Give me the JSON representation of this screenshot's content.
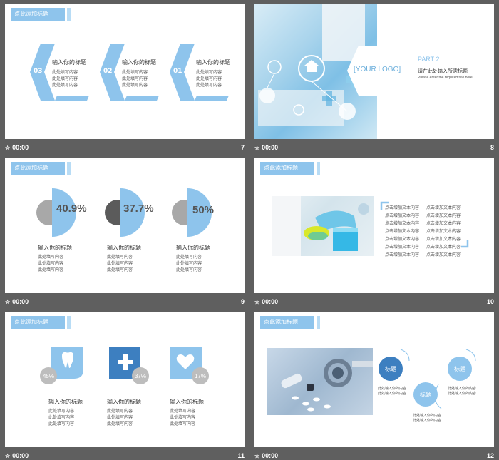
{
  "colors": {
    "accent": "#8ec4ec",
    "light": "#b8dcf5",
    "dark": "#3d7fc0",
    "gray": "#a8a8a8",
    "frame": "#5f5f5f"
  },
  "footer_time": "00:00",
  "slides": {
    "s7": {
      "num": "7",
      "title": "点此添加标题",
      "items": [
        {
          "no": "03",
          "heading": "输入你的标题",
          "lines": [
            "此处填写内容",
            "此处填写内容",
            "此处填写内容"
          ]
        },
        {
          "no": "02",
          "heading": "输入你的标题",
          "lines": [
            "此处填写内容",
            "此处填写内容",
            "此处填写内容"
          ]
        },
        {
          "no": "01",
          "heading": "输入你的标题",
          "lines": [
            "此处填写内容",
            "此处填写内容",
            "此处填写内容"
          ]
        }
      ]
    },
    "s8": {
      "num": "8",
      "logo": "[YOUR LOGO]",
      "part": "PART 2",
      "cn_title": "请在此处输入所需标题",
      "en_title": "Please enter the required title here"
    },
    "s9": {
      "num": "9",
      "title": "点此添加标题",
      "items": [
        {
          "pct": "40.9%",
          "heading": "输入你的标题",
          "lines": [
            "此处填写内容",
            "此处填写内容",
            "此处填写内容"
          ]
        },
        {
          "pct": "37.7%",
          "heading": "输入你的标题",
          "lines": [
            "此处填写内容",
            "此处填写内容",
            "此处填写内容"
          ]
        },
        {
          "pct": "50%",
          "heading": "输入你的标题",
          "lines": [
            "此处填写内容",
            "此处填写内容",
            "此处填写内容"
          ]
        }
      ]
    },
    "s10": {
      "num": "10",
      "title": "点此添加标题",
      "col1": [
        "点击增加文本内容",
        "点击增加文本内容",
        "点击增加文本内容",
        "点击增加文本内容",
        "点击增加文本内容",
        "点击增加文本内容",
        "点击增加文本内容"
      ],
      "col2": [
        "点击增加文本内容",
        "点击增加文本内容",
        "点击增加文本内容",
        "点击增加文本内容",
        "点击增加文本内容",
        "点击增加文本内容",
        "点击增加文本内容"
      ]
    },
    "s11": {
      "num": "11",
      "title": "点此添加标题",
      "items": [
        {
          "pct": "45%",
          "icon": "tooth-icon",
          "heading": "输入你的标题",
          "lines": [
            "此处填写内容",
            "此处填写内容",
            "此处填写内容"
          ]
        },
        {
          "pct": "37%",
          "icon": "plus-icon",
          "heading": "输入你的标题",
          "lines": [
            "此处填写内容",
            "此处填写内容",
            "此处填写内容"
          ]
        },
        {
          "pct": "17%",
          "icon": "heart-icon",
          "heading": "输入你的标题",
          "lines": [
            "此处填写内容",
            "此处填写内容",
            "此处填写内容"
          ]
        }
      ]
    },
    "s12": {
      "num": "12",
      "title": "点此添加标题",
      "circles": [
        {
          "label": "标题",
          "lines": [
            "此处输入你的内容",
            "此处输入你的内容"
          ]
        },
        {
          "label": "标题",
          "lines": [
            "此处输入你的内容",
            "此处输入你的内容"
          ]
        },
        {
          "label": "标题",
          "lines": [
            "此处输入你的内容",
            "此处输入你的内容"
          ]
        }
      ]
    }
  }
}
